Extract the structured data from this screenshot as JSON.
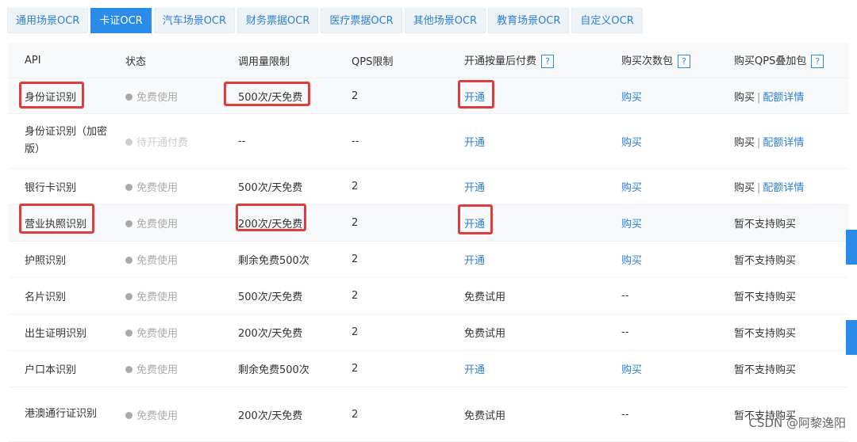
{
  "tabs": [
    "通用场景OCR",
    "卡证OCR",
    "汽车场景OCR",
    "财务票据OCR",
    "医疗票据OCR",
    "其他场景OCR",
    "教育场景OCR",
    "自定义OCR"
  ],
  "active_tab": "卡证OCR",
  "columns": [
    "API",
    "状态",
    "调用量限制",
    "QPS限制",
    "开通按量后付费",
    "购买次数包",
    "购买QPS叠加包"
  ],
  "help_glyph": "?",
  "rows": [
    {
      "api": "身份证识别",
      "status": "免费使用",
      "limit": "500次/天免费",
      "qps": "2",
      "postpay": "开通",
      "pack": "购买",
      "qps_buy": "购买",
      "qps_detail": "配额详情"
    },
    {
      "api": "身份证识别（加密版）",
      "status": "待开通付费",
      "limit": "--",
      "qps": "--",
      "postpay": "开通",
      "pack": "购买",
      "qps_buy": "购买",
      "qps_detail": "配额详情"
    },
    {
      "api": "银行卡识别",
      "status": "免费使用",
      "limit": "500次/天免费",
      "qps": "2",
      "postpay": "开通",
      "pack": "购买",
      "qps_buy": "购买",
      "qps_detail": "配额详情"
    },
    {
      "api": "营业执照识别",
      "status": "免费使用",
      "limit": "200次/天免费",
      "qps": "2",
      "postpay": "开通",
      "pack": "购买",
      "qps_buy": "暂不支持购买"
    },
    {
      "api": "护照识别",
      "status": "免费使用",
      "limit": "剩余免费500次",
      "qps": "2",
      "postpay": "开通",
      "pack": "购买",
      "qps_buy": "暂不支持购买"
    },
    {
      "api": "名片识别",
      "status": "免费使用",
      "limit": "500次/天免费",
      "qps": "2",
      "postpay": "免费试用",
      "pack": "--",
      "qps_buy": "暂不支持购买"
    },
    {
      "api": "出生证明识别",
      "status": "免费使用",
      "limit": "200次/天免费",
      "qps": "2",
      "postpay": "免费试用",
      "pack": "--",
      "qps_buy": "暂不支持购买"
    },
    {
      "api": "户口本识别",
      "status": "免费使用",
      "limit": "剩余免费500次",
      "qps": "2",
      "postpay": "开通",
      "pack": "购买",
      "qps_buy": "暂不支持购买"
    },
    {
      "api": "港澳通行证识别",
      "status": "免费使用",
      "limit": "200次/天免费",
      "qps": "2",
      "postpay": "免费试用",
      "pack": "--",
      "qps_buy": "暂不支持购买"
    }
  ],
  "watermark": "CSDN @阿黎逸阳",
  "colors": {
    "accent": "#2a8be8",
    "link": "#2b7fd4",
    "highlight": "#e23b3b",
    "status_dot": "#aaaaaa",
    "status_dot_pending": "#cccccc"
  }
}
